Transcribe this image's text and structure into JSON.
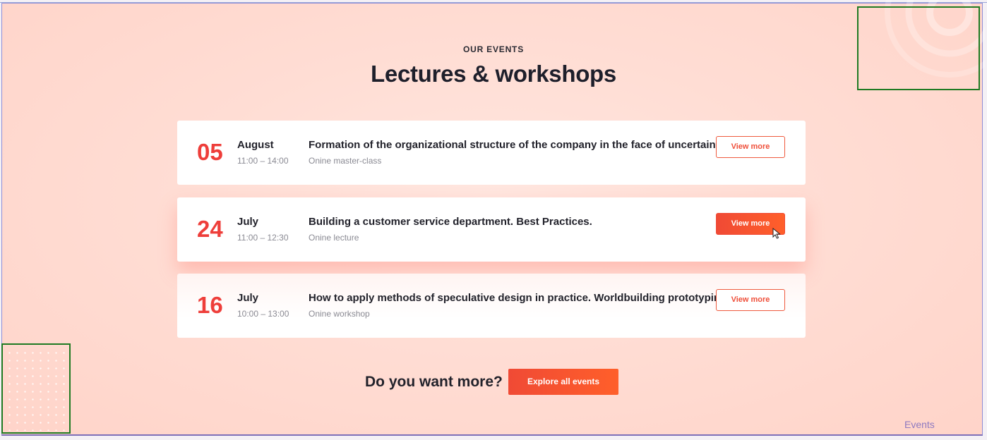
{
  "section": {
    "eyebrow": "OUR EVENTS",
    "title": "Lectures & workshops"
  },
  "events": [
    {
      "day": "05",
      "month": "August",
      "time": "11:00 – 14:00",
      "title": "Formation of the organizational structure of the company in the face of uncertainty.",
      "type": "Onine master-class",
      "button": "View more"
    },
    {
      "day": "24",
      "month": "July",
      "time": "11:00 – 12:30",
      "title": "Building a customer service department. Best Practices.",
      "type": "Onine lecture",
      "button": "View more"
    },
    {
      "day": "16",
      "month": "July",
      "time": "10:00 – 13:00",
      "title": "How to apply methods of speculative design in practice. Worldbuilding prototyping.",
      "type": "Onine workshop",
      "button": "View more"
    }
  ],
  "cta": {
    "prompt": "Do you want more?",
    "button": "Explore all events"
  },
  "corner_label": "Events",
  "colors": {
    "accent": "#ef4f3a",
    "background": "#ffddd4",
    "heading": "#1e1f2b"
  }
}
